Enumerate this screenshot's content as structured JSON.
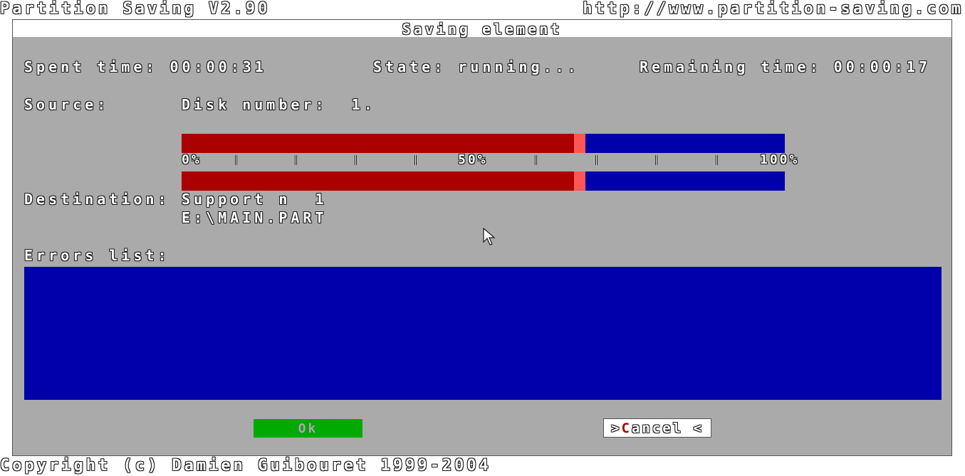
{
  "app": {
    "title": "Partition Saving V2.90",
    "url": "http://www.partition-saving.com",
    "copyright": "Copyright (c) Damien Guibouret 1999-2004"
  },
  "dialog": {
    "title": "Saving element",
    "spent_time_label": "Spent time: 00:00:31",
    "state_label": "State: running...",
    "remaining_time_label": "Remaining time: 00:00:17",
    "source_label": "Source:",
    "source_value": "Disk number:  1.",
    "destination_label": "Destination:",
    "destination_support": "Support n  1",
    "destination_path": "E:\\MAIN.PART",
    "errors_label": "Errors list:",
    "errors": [],
    "progress_top_fraction": 0.65,
    "progress_bottom_fraction": 0.65,
    "scale": {
      "start": "0%",
      "middle": "50%",
      "end": "100%"
    }
  },
  "buttons": {
    "ok": "Ok",
    "cancel_prefix": ">",
    "cancel_hotkey": "C",
    "cancel_rest": "ancel <"
  },
  "colors": {
    "window_bg": "#aaaaaa",
    "bar_done": "#aa0000",
    "bar_remaining": "#0000aa",
    "bar_cursor": "#ff5555",
    "ok_bg": "#00aa00",
    "errors_bg": "#0000aa"
  },
  "icons": {
    "mouse_pointer": "mouse-pointer-icon"
  }
}
